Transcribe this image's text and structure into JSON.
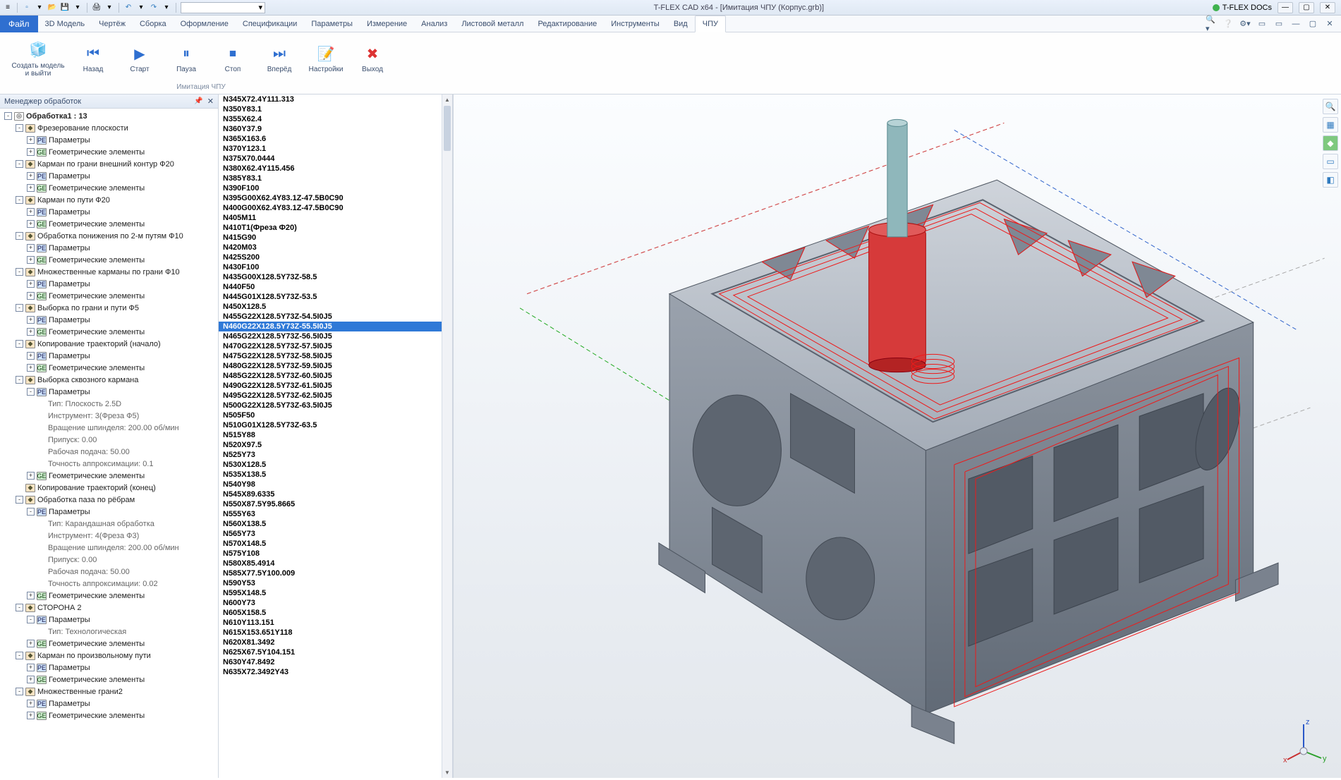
{
  "title": "T-FLEX CAD x64 - [Имитация ЧПУ (Корпус.grb)]",
  "docs_label": "T-FLEX DOCs",
  "ribbon_tabs": [
    "3D Модель",
    "Чертёж",
    "Сборка",
    "Оформление",
    "Спецификации",
    "Параметры",
    "Измерение",
    "Анализ",
    "Листовой металл",
    "Редактирование",
    "Инструменты",
    "Вид",
    "ЧПУ"
  ],
  "file_tab": "Файл",
  "ribbon": {
    "group_caption": "Имитация ЧПУ",
    "create_model": "Создать модель\nи выйти",
    "back": "Назад",
    "start": "Старт",
    "pause": "Пауза",
    "stop": "Стоп",
    "fwd": "Вперёд",
    "settings": "Настройки",
    "exit": "Выход"
  },
  "panel_title": "Менеджер обработок",
  "tree": [
    {
      "d": 0,
      "e": "-",
      "i": "root",
      "t": "Обработка1 : 13",
      "bold": true
    },
    {
      "d": 1,
      "e": "-",
      "i": "op",
      "t": "Фрезерование плоскости"
    },
    {
      "d": 2,
      "e": "+",
      "i": "pe",
      "t": "Параметры"
    },
    {
      "d": 2,
      "e": "+",
      "i": "ge",
      "t": "Геометрические элементы"
    },
    {
      "d": 1,
      "e": "-",
      "i": "op",
      "t": "Карман по грани внешний контур Ф20"
    },
    {
      "d": 2,
      "e": "+",
      "i": "pe",
      "t": "Параметры"
    },
    {
      "d": 2,
      "e": "+",
      "i": "ge",
      "t": "Геометрические элементы"
    },
    {
      "d": 1,
      "e": "-",
      "i": "op",
      "t": "Карман по пути Ф20"
    },
    {
      "d": 2,
      "e": "+",
      "i": "pe",
      "t": "Параметры"
    },
    {
      "d": 2,
      "e": "+",
      "i": "ge",
      "t": "Геометрические элементы"
    },
    {
      "d": 1,
      "e": "-",
      "i": "op",
      "t": "Обработка понижения по 2-м путям Ф10"
    },
    {
      "d": 2,
      "e": "+",
      "i": "pe",
      "t": "Параметры"
    },
    {
      "d": 2,
      "e": "+",
      "i": "ge",
      "t": "Геометрические элементы"
    },
    {
      "d": 1,
      "e": "-",
      "i": "op",
      "t": "Множественные карманы по грани Ф10"
    },
    {
      "d": 2,
      "e": "+",
      "i": "pe",
      "t": "Параметры"
    },
    {
      "d": 2,
      "e": "+",
      "i": "ge",
      "t": "Геометрические элементы"
    },
    {
      "d": 1,
      "e": "-",
      "i": "op",
      "t": "Выборка по грани и пути Ф5"
    },
    {
      "d": 2,
      "e": "+",
      "i": "pe",
      "t": "Параметры"
    },
    {
      "d": 2,
      "e": "+",
      "i": "ge",
      "t": "Геометрические элементы"
    },
    {
      "d": 1,
      "e": "-",
      "i": "op",
      "t": "Копирование траекторий (начало)"
    },
    {
      "d": 2,
      "e": "+",
      "i": "pe",
      "t": "Параметры"
    },
    {
      "d": 2,
      "e": "+",
      "i": "ge",
      "t": "Геометрические элементы"
    },
    {
      "d": 1,
      "e": "-",
      "i": "op",
      "t": "Выборка сквозного кармана"
    },
    {
      "d": 2,
      "e": "-",
      "i": "pe",
      "t": "Параметры"
    },
    {
      "d": 3,
      "e": " ",
      "i": "",
      "t": "Тип: Плоскость 2.5D",
      "dim": true
    },
    {
      "d": 3,
      "e": " ",
      "i": "",
      "t": "Инструмент: 3(Фреза Ф5)",
      "dim": true
    },
    {
      "d": 3,
      "e": " ",
      "i": "",
      "t": "Вращение шпинделя: 200.00 об/мин",
      "dim": true
    },
    {
      "d": 3,
      "e": " ",
      "i": "",
      "t": "Припуск: 0.00",
      "dim": true
    },
    {
      "d": 3,
      "e": " ",
      "i": "",
      "t": "Рабочая подача: 50.00",
      "dim": true
    },
    {
      "d": 3,
      "e": " ",
      "i": "",
      "t": "Точность аппроксимации: 0.1",
      "dim": true
    },
    {
      "d": 2,
      "e": "+",
      "i": "ge",
      "t": "Геометрические элементы"
    },
    {
      "d": 1,
      "e": " ",
      "i": "op",
      "t": "Копирование траекторий (конец)"
    },
    {
      "d": 1,
      "e": "-",
      "i": "op",
      "t": "Обработка паза по рёбрам"
    },
    {
      "d": 2,
      "e": "-",
      "i": "pe",
      "t": "Параметры"
    },
    {
      "d": 3,
      "e": " ",
      "i": "",
      "t": "Тип: Карандашная обработка",
      "dim": true
    },
    {
      "d": 3,
      "e": " ",
      "i": "",
      "t": "Инструмент: 4(Фреза Ф3)",
      "dim": true
    },
    {
      "d": 3,
      "e": " ",
      "i": "",
      "t": "Вращение шпинделя: 200.00 об/мин",
      "dim": true
    },
    {
      "d": 3,
      "e": " ",
      "i": "",
      "t": "Припуск: 0.00",
      "dim": true
    },
    {
      "d": 3,
      "e": " ",
      "i": "",
      "t": "Рабочая подача: 50.00",
      "dim": true
    },
    {
      "d": 3,
      "e": " ",
      "i": "",
      "t": "Точность аппроксимации: 0.02",
      "dim": true
    },
    {
      "d": 2,
      "e": "+",
      "i": "ge",
      "t": "Геометрические элементы"
    },
    {
      "d": 1,
      "e": "-",
      "i": "op",
      "t": "СТОРОНА 2"
    },
    {
      "d": 2,
      "e": "-",
      "i": "pe",
      "t": "Параметры"
    },
    {
      "d": 3,
      "e": " ",
      "i": "",
      "t": "Тип: Технологическая",
      "dim": true
    },
    {
      "d": 2,
      "e": "+",
      "i": "ge",
      "t": "Геометрические элементы"
    },
    {
      "d": 1,
      "e": "-",
      "i": "op",
      "t": "Карман по произвольному пути"
    },
    {
      "d": 2,
      "e": "+",
      "i": "pe",
      "t": "Параметры"
    },
    {
      "d": 2,
      "e": "+",
      "i": "ge",
      "t": "Геометрические элементы"
    },
    {
      "d": 1,
      "e": "-",
      "i": "op",
      "t": "Множественные грани2"
    },
    {
      "d": 2,
      "e": "+",
      "i": "pe",
      "t": "Параметры"
    },
    {
      "d": 2,
      "e": "+",
      "i": "ge",
      "t": "Геометрические элементы"
    }
  ],
  "gcode_selected": "N460G22X128.5Y73Z-55.5I0J5",
  "gcode": [
    "N345X72.4Y111.313",
    "N350Y83.1",
    "N355X62.4",
    "N360Y37.9",
    "N365X163.6",
    "N370Y123.1",
    "N375X70.0444",
    "N380X62.4Y115.456",
    "N385Y83.1",
    "N390F100",
    "N395G00X62.4Y83.1Z-47.5B0C90",
    "N400G00X62.4Y83.1Z-47.5B0C90",
    "N405M11",
    "N410T1(Фреза Ф20)",
    "N415G90",
    "N420M03",
    "N425S200",
    "N430F100",
    "N435G00X128.5Y73Z-58.5",
    "N440F50",
    "N445G01X128.5Y73Z-53.5",
    "N450X128.5",
    "N455G22X128.5Y73Z-54.5I0J5",
    "N460G22X128.5Y73Z-55.5I0J5",
    "N465G22X128.5Y73Z-56.5I0J5",
    "N470G22X128.5Y73Z-57.5I0J5",
    "N475G22X128.5Y73Z-58.5I0J5",
    "N480G22X128.5Y73Z-59.5I0J5",
    "N485G22X128.5Y73Z-60.5I0J5",
    "N490G22X128.5Y73Z-61.5I0J5",
    "N495G22X128.5Y73Z-62.5I0J5",
    "N500G22X128.5Y73Z-63.5I0J5",
    "N505F50",
    "N510G01X128.5Y73Z-63.5",
    "N515Y88",
    "N520X97.5",
    "N525Y73",
    "N530X128.5",
    "N535X138.5",
    "N540Y98",
    "N545X89.6335",
    "N550X87.5Y95.8665",
    "N555Y63",
    "N560X138.5",
    "N565Y73",
    "N570X148.5",
    "N575Y108",
    "N580X85.4914",
    "N585X77.5Y100.009",
    "N590Y53",
    "N595X148.5",
    "N600Y73",
    "N605X158.5",
    "N610Y113.151",
    "N615X153.651Y118",
    "N620X81.3492",
    "N625X67.5Y104.151",
    "N630Y47.8492",
    "N635X72.3492Y43"
  ],
  "triad": {
    "x": "x",
    "y": "y",
    "z": "z"
  }
}
